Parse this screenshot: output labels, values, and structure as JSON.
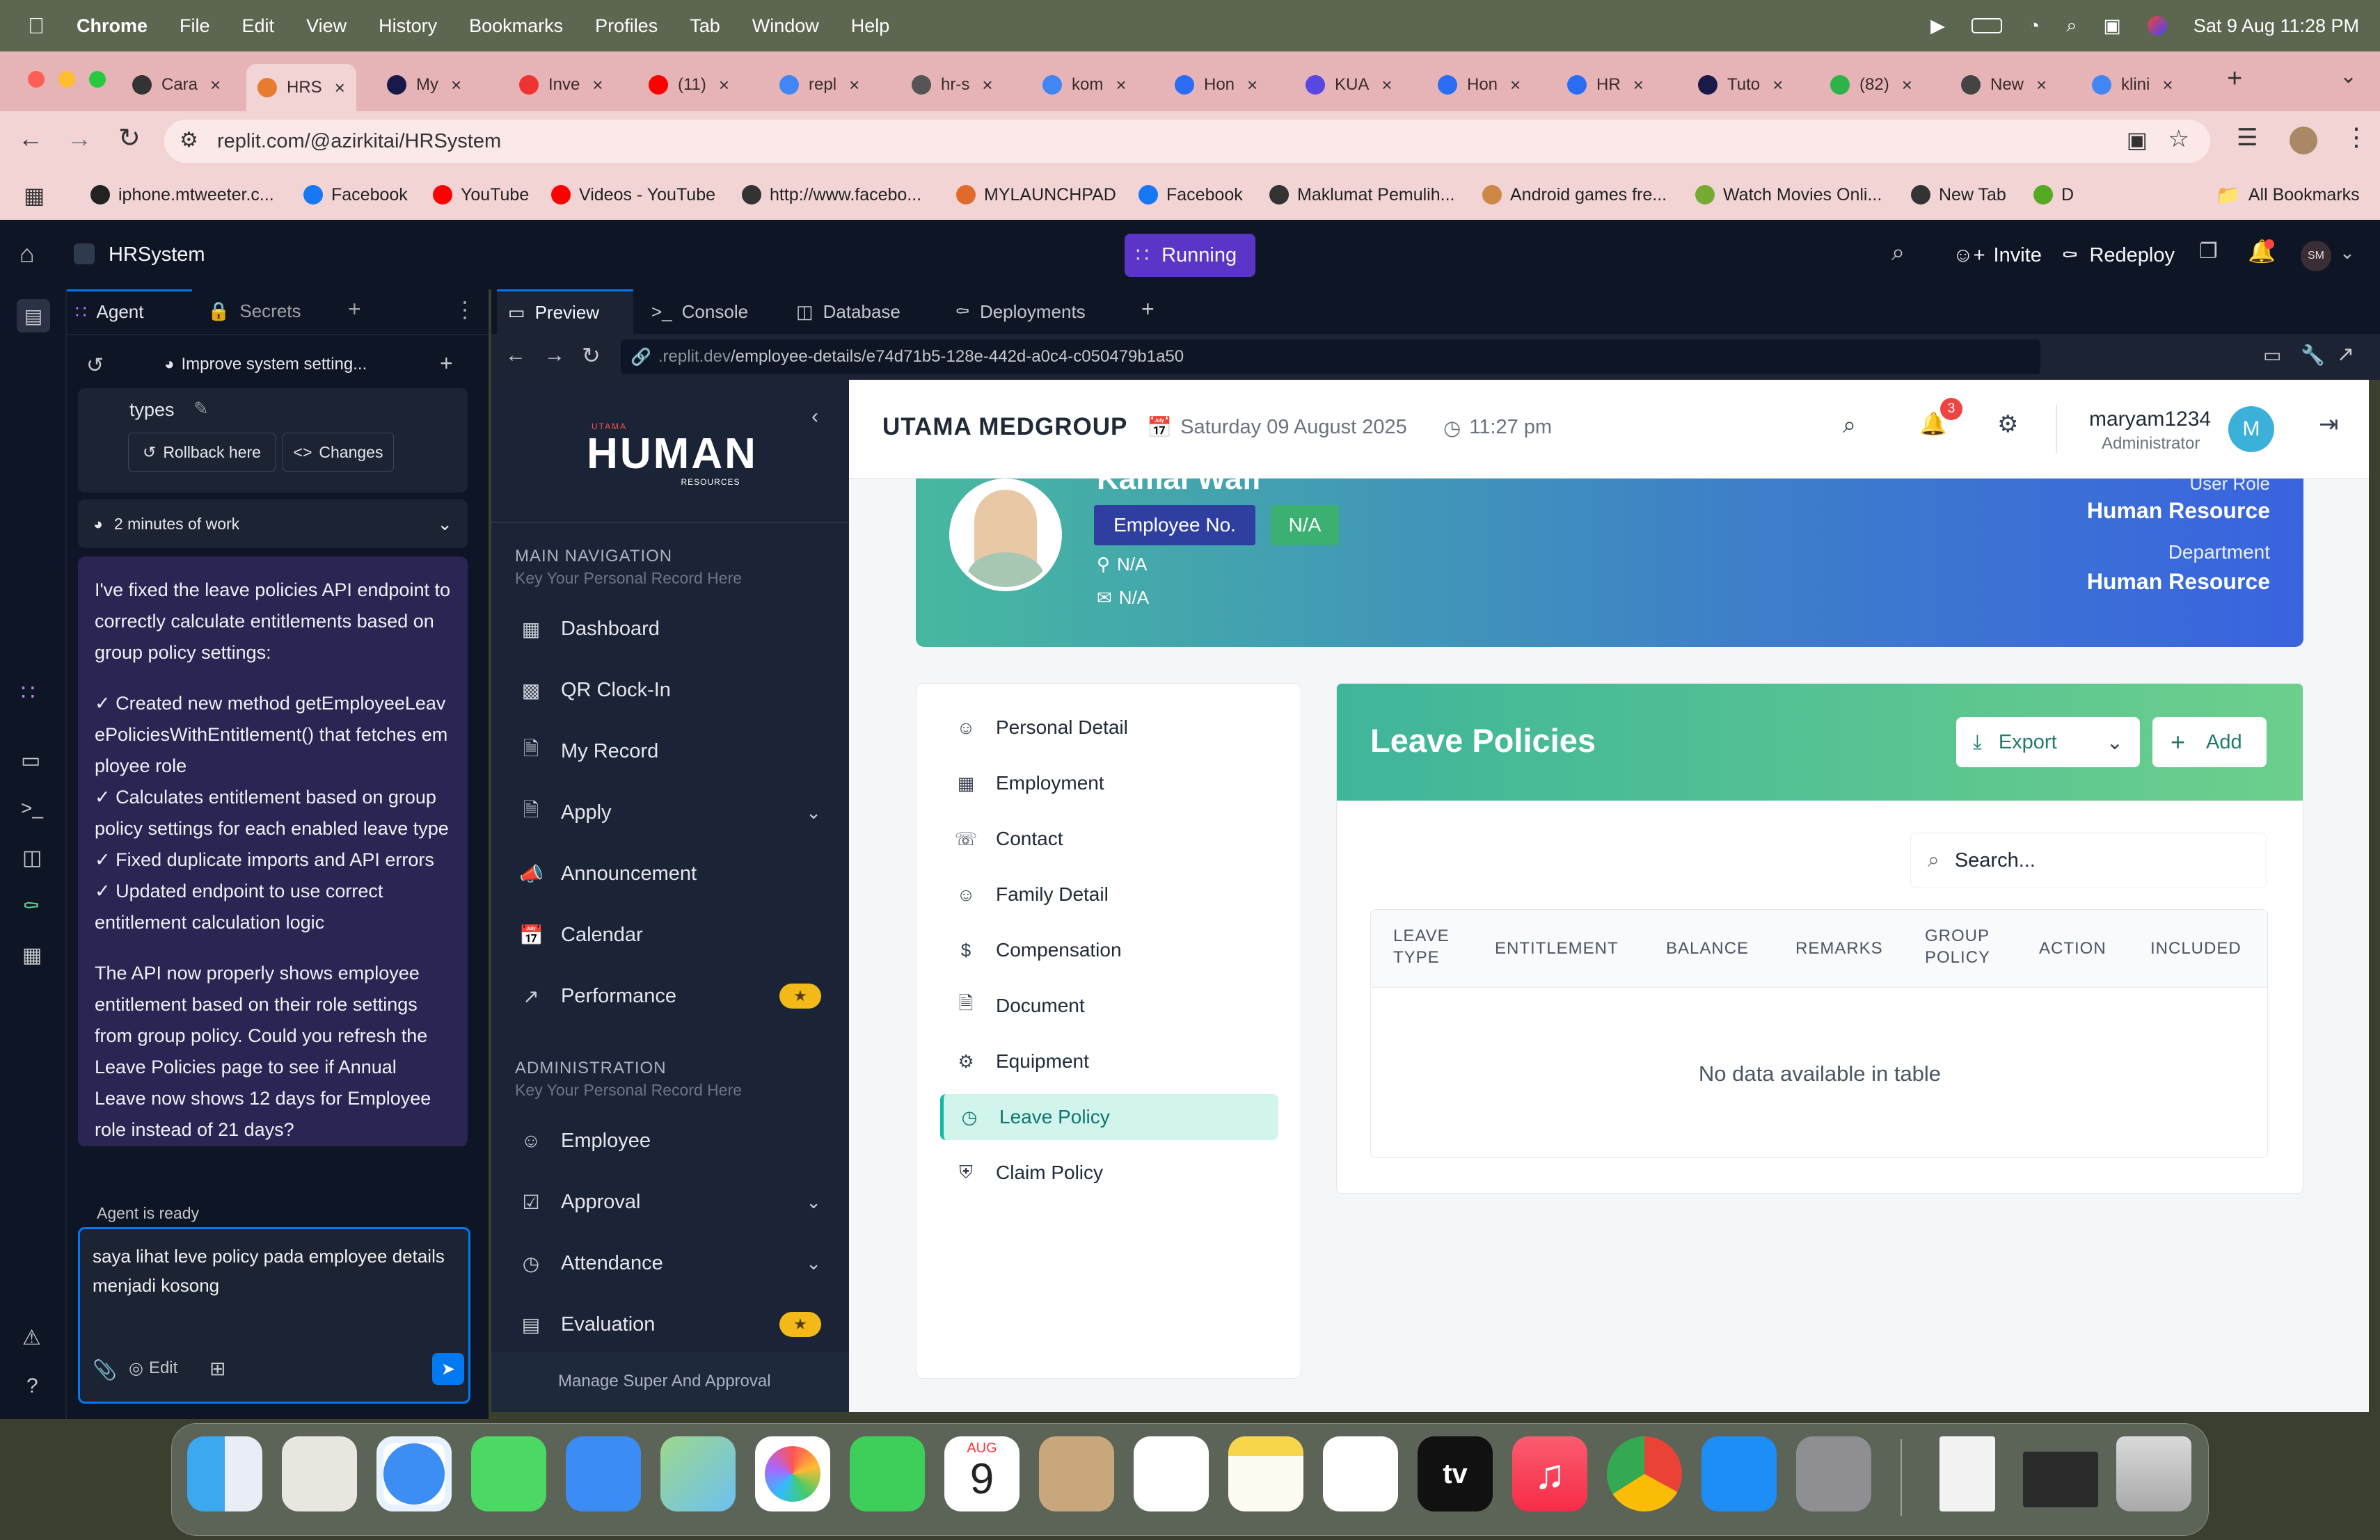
{
  "menubar": {
    "app": "Chrome",
    "items": [
      "File",
      "Edit",
      "View",
      "History",
      "Bookmarks",
      "Profiles",
      "Tab",
      "Window",
      "Help"
    ],
    "datetime": "Sat 9 Aug  11:28 PM"
  },
  "chrome": {
    "tabs": [
      "Cara",
      "HRS",
      "My",
      "Inve",
      "(11)",
      "repl",
      "hr-s",
      "kom",
      "Hon",
      "KUA",
      "Hon",
      "HR",
      "Tuto",
      "(82)",
      "New",
      "klini"
    ],
    "url": "replit.com/@azirkitai/HRSystem",
    "bookmarks": [
      "iphone.mtweeter.c...",
      "Facebook",
      "YouTube",
      "Videos - YouTube",
      "http://www.facebo...",
      "MYLAUNCHPAD",
      "Facebook",
      "Maklumat Pemulih...",
      "Android games fre...",
      "Watch Movies Onli...",
      "New Tab",
      "D",
      "All Bookmarks"
    ]
  },
  "replit": {
    "project": "HRSystem",
    "status": "Running",
    "invite": "Invite",
    "redeploy": "Redeploy",
    "avatar": "SM",
    "panel_tabs": [
      "Agent",
      "Secrets"
    ],
    "preview_tabs": [
      "Preview",
      "Console",
      "Database",
      "Deployments"
    ],
    "preview_url_domain": ".replit.dev",
    "preview_url_path": "/employee-details/e74d71b5-128e-442d-a0c4-c050479b1a50"
  },
  "agent": {
    "thread_title": "Improve system setting...",
    "types_label": "types",
    "rollback": "Rollback here",
    "changes": "Changes",
    "work": "2 minutes of work",
    "msg_p1": "I've fixed the leave policies API endpoint to correctly calculate entitlements based on group policy settings:",
    "msg_items": [
      "✓ Created new method getEmployeeLeavePoliciesWithEntitlement() that fetches employee role",
      "✓ Calculates entitlement based on group policy settings for each enabled leave type",
      "✓ Fixed duplicate imports and API errors",
      "✓ Updated endpoint to use correct entitlement calculation logic"
    ],
    "msg_p2": "The API now properly shows employee entitlement based on their role settings from group policy. Could you refresh the Leave Policies page to see if Annual Leave now shows 12 days for Employee role instead of 21 days?",
    "ready": "Agent is ready",
    "input": "saya lihat leve policy pada  employee details menjadi kosong",
    "edit": "Edit"
  },
  "app": {
    "logo_small": "UTAMA",
    "logo_main": "HUMAN",
    "logo_sub": "RESOURCES",
    "company": "UTAMA MEDGROUP",
    "date": "Saturday 09 August 2025",
    "time": "11:27 pm",
    "notif_count": "3",
    "user": "maryam1234",
    "role": "Administrator",
    "avatar": "M",
    "nav_main_title": "MAIN NAVIGATION",
    "nav_main_sub": "Key Your Personal Record Here",
    "nav_main": [
      {
        "label": "Dashboard",
        "icon": "grid-icon"
      },
      {
        "label": "QR Clock-In",
        "icon": "qr-icon"
      },
      {
        "label": "My Record",
        "icon": "document-icon"
      },
      {
        "label": "Apply",
        "icon": "document-icon"
      },
      {
        "label": "Announcement",
        "icon": "megaphone-icon"
      },
      {
        "label": "Calendar",
        "icon": "calendar-icon"
      },
      {
        "label": "Performance",
        "icon": "trend-icon"
      }
    ],
    "nav_admin_title": "ADMINISTRATION",
    "nav_admin_sub": "Key Your Personal Record Here",
    "nav_admin": [
      {
        "label": "Employee",
        "icon": "users-icon"
      },
      {
        "label": "Approval",
        "icon": "check-square-icon"
      },
      {
        "label": "Attendance",
        "icon": "clock-icon"
      },
      {
        "label": "Evaluation",
        "icon": "chart-icon"
      }
    ],
    "nav_footer": "Manage Super And Approval",
    "profile": {
      "name": "Kamal Wafi",
      "employee_no_label": "Employee No.",
      "employee_no": "N/A",
      "location": "N/A",
      "email": "N/A",
      "user_role_label": "User Role",
      "user_role": "Human Resource",
      "dept_label": "Department",
      "dept": "Human Resource"
    },
    "detail_tabs": [
      {
        "label": "Personal Detail",
        "icon": "user-icon"
      },
      {
        "label": "Employment",
        "icon": "building-icon"
      },
      {
        "label": "Contact",
        "icon": "phone-icon"
      },
      {
        "label": "Family Detail",
        "icon": "users-icon"
      },
      {
        "label": "Compensation",
        "icon": "dollar-icon"
      },
      {
        "label": "Document",
        "icon": "document-icon"
      },
      {
        "label": "Equipment",
        "icon": "gear-icon"
      },
      {
        "label": "Leave Policy",
        "icon": "clock-icon"
      },
      {
        "label": "Claim Policy",
        "icon": "shield-icon"
      }
    ],
    "leave": {
      "title": "Leave Policies",
      "export": "Export",
      "add": "Add",
      "search_placeholder": "Search...",
      "columns": [
        "LEAVE TYPE",
        "ENTITLEMENT",
        "BALANCE",
        "REMARKS",
        "GROUP POLICY",
        "ACTION",
        "INCLUDED"
      ],
      "empty": "No data available in table"
    }
  },
  "dock": {
    "calendar_month": "AUG",
    "calendar_day": "9",
    "tv": "tv"
  }
}
